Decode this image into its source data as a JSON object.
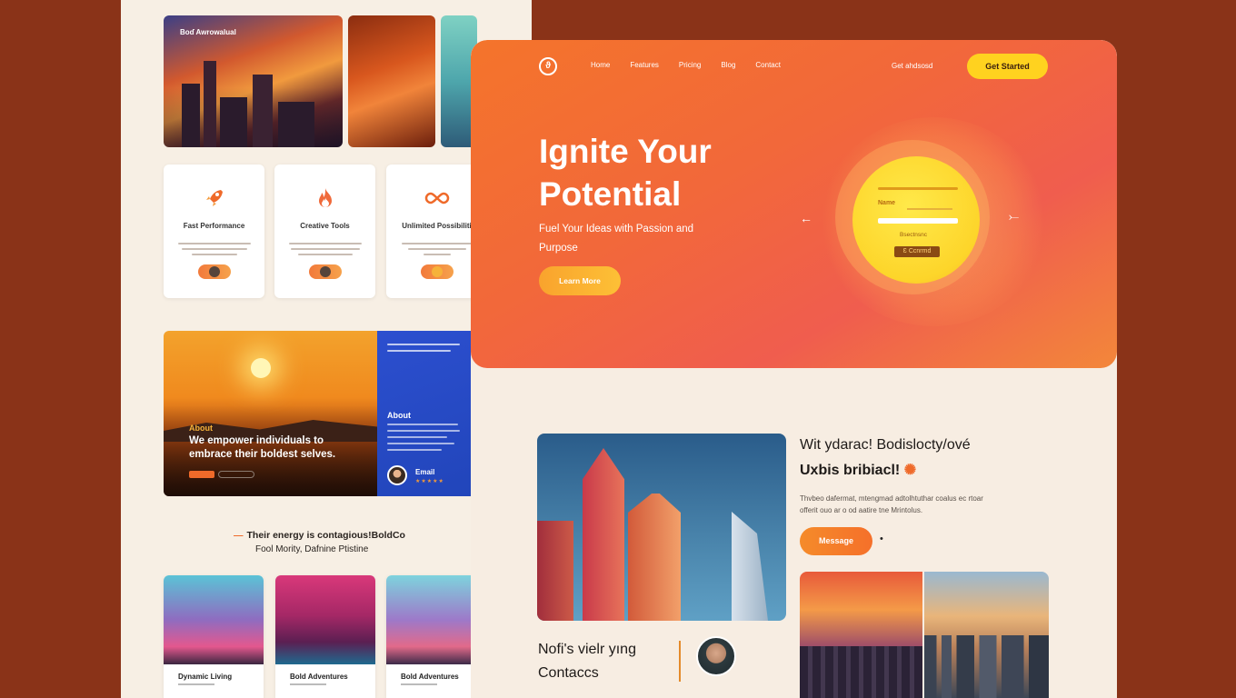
{
  "back": {
    "top_caption": "Boɗ Awrowalual",
    "features": [
      {
        "title": "Fast Performance",
        "icon": "rocket-icon"
      },
      {
        "title": "Creative Tools",
        "icon": "flame-icon"
      },
      {
        "title": "Unlimited Possibiliti",
        "icon": "infinity-icon"
      }
    ],
    "about": {
      "kicker": "About",
      "headline": "We empower individuals to embrace their boldest selves.",
      "side_title": "About",
      "email_label": "Email",
      "stars": "★★★★★"
    },
    "testimonial": {
      "line1": "Their energy is contagious!",
      "line1_suffix": "BoldCo",
      "line2": "Fool Mority,  Dafnine Ptistine"
    },
    "cities": [
      {
        "title": "Dynamic Living"
      },
      {
        "title": "Bold Adventures"
      },
      {
        "title": "Bold Adventures"
      }
    ]
  },
  "nav": {
    "items": [
      "Home",
      "Features",
      "Pricing",
      "Blog",
      "Contact"
    ],
    "contact_link": "Get ahdsosd",
    "cta": "Get Started"
  },
  "hero": {
    "title": "Ignite Your Potential",
    "subtitle": "Fuel Your Ideas with Passion and Purpose",
    "button": "Learn More",
    "form": {
      "name_label": "Name",
      "caption": "Bsectnsnc",
      "button": "Ɛ Ccnrmd"
    }
  },
  "section": {
    "heading_line1": "Wit ydarac! Bodislocty/ové",
    "heading_line2": "Uxbis bribiacl!",
    "body_line1": "Thvbeo dafermat, mtengmad adtolhtuthar coalus ec rtoar",
    "body_line2": "offerit ouo ar o od aatire tne Mrintolus.",
    "button": "Message"
  },
  "contact": {
    "line1": "Nofi's vielr yıng",
    "line2": "Contaccs"
  },
  "colors": {
    "accent": "#ef6a2a",
    "cta_yellow": "#ffd21f",
    "page_bg": "#8a3318",
    "cream": "#f7ede2",
    "blue": "#2c4fcf"
  }
}
